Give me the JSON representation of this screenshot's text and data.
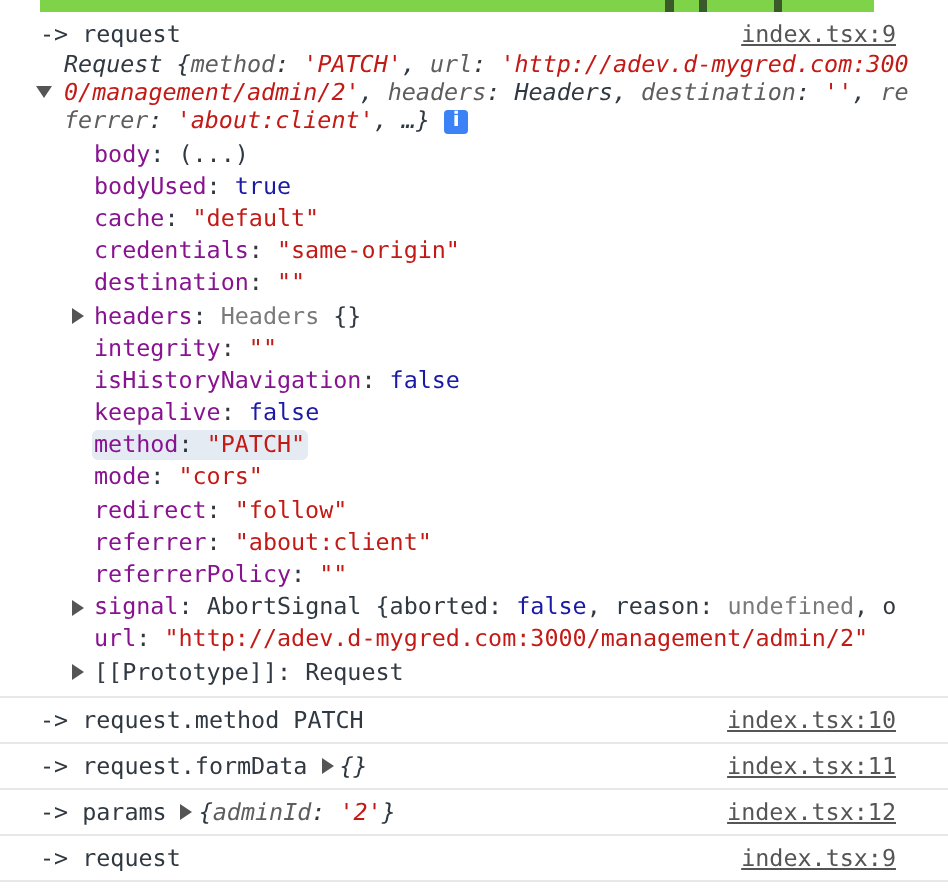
{
  "entries": [
    {
      "message": "-> request",
      "source": "index.tsx:9",
      "object": {
        "expanded": true,
        "info_badge": "i",
        "preview": [
          {
            "text": "Request ",
            "kind": "name"
          },
          {
            "text": "{",
            "kind": "punct"
          },
          {
            "text": "method",
            "kind": "key"
          },
          {
            "text": ": ",
            "kind": "punct"
          },
          {
            "text": "'PATCH'",
            "kind": "string"
          },
          {
            "text": ", ",
            "kind": "punct"
          },
          {
            "text": "url",
            "kind": "key"
          },
          {
            "text": ": ",
            "kind": "punct"
          },
          {
            "text": "'http://adev.d-mygred.com:3000/management/admin/2'",
            "kind": "string"
          },
          {
            "text": ", ",
            "kind": "punct"
          },
          {
            "text": "headers",
            "kind": "key"
          },
          {
            "text": ": ",
            "kind": "punct"
          },
          {
            "text": "Headers",
            "kind": "name"
          },
          {
            "text": ", ",
            "kind": "punct"
          },
          {
            "text": "destination",
            "kind": "key"
          },
          {
            "text": ": ",
            "kind": "punct"
          },
          {
            "text": "''",
            "kind": "string"
          },
          {
            "text": ", ",
            "kind": "punct"
          },
          {
            "text": "referrer",
            "kind": "key"
          },
          {
            "text": ": ",
            "kind": "punct"
          },
          {
            "text": "'about:client'",
            "kind": "string"
          },
          {
            "text": ", …}",
            "kind": "punct"
          }
        ],
        "properties": [
          {
            "key": "body",
            "internal": false,
            "highlighted": false,
            "value": [
              {
                "text": ": ",
                "kind": "punct"
              },
              {
                "text": "(...)",
                "kind": "plain"
              }
            ]
          },
          {
            "key": "bodyUsed",
            "internal": false,
            "highlighted": false,
            "value": [
              {
                "text": ": ",
                "kind": "punct"
              },
              {
                "text": "true",
                "kind": "keyword"
              }
            ]
          },
          {
            "key": "cache",
            "internal": false,
            "highlighted": false,
            "value": [
              {
                "text": ": ",
                "kind": "punct"
              },
              {
                "text": "\"default\"",
                "kind": "string"
              }
            ]
          },
          {
            "key": "credentials",
            "internal": false,
            "highlighted": false,
            "value": [
              {
                "text": ": ",
                "kind": "punct"
              },
              {
                "text": "\"same-origin\"",
                "kind": "string"
              }
            ]
          },
          {
            "key": "destination",
            "internal": false,
            "highlighted": false,
            "value": [
              {
                "text": ": ",
                "kind": "punct"
              },
              {
                "text": "\"\"",
                "kind": "string"
              }
            ]
          },
          {
            "key": "headers",
            "internal": false,
            "expanded": false,
            "highlighted": false,
            "value": [
              {
                "text": ": ",
                "kind": "punct"
              },
              {
                "text": "Headers ",
                "kind": "dim"
              },
              {
                "text": "{}",
                "kind": "plain"
              }
            ]
          },
          {
            "key": "integrity",
            "internal": false,
            "highlighted": false,
            "value": [
              {
                "text": ": ",
                "kind": "punct"
              },
              {
                "text": "\"\"",
                "kind": "string"
              }
            ]
          },
          {
            "key": "isHistoryNavigation",
            "internal": false,
            "highlighted": false,
            "value": [
              {
                "text": ": ",
                "kind": "punct"
              },
              {
                "text": "false",
                "kind": "keyword"
              }
            ]
          },
          {
            "key": "keepalive",
            "internal": false,
            "highlighted": false,
            "value": [
              {
                "text": ": ",
                "kind": "punct"
              },
              {
                "text": "false",
                "kind": "keyword"
              }
            ]
          },
          {
            "key": "method",
            "internal": false,
            "highlighted": true,
            "value": [
              {
                "text": ": ",
                "kind": "punct"
              },
              {
                "text": "\"PATCH\"",
                "kind": "string"
              }
            ]
          },
          {
            "key": "mode",
            "internal": false,
            "highlighted": false,
            "value": [
              {
                "text": ": ",
                "kind": "punct"
              },
              {
                "text": "\"cors\"",
                "kind": "string"
              }
            ]
          },
          {
            "key": "redirect",
            "internal": false,
            "highlighted": false,
            "value": [
              {
                "text": ": ",
                "kind": "punct"
              },
              {
                "text": "\"follow\"",
                "kind": "string"
              }
            ]
          },
          {
            "key": "referrer",
            "internal": false,
            "highlighted": false,
            "value": [
              {
                "text": ": ",
                "kind": "punct"
              },
              {
                "text": "\"about:client\"",
                "kind": "string"
              }
            ]
          },
          {
            "key": "referrerPolicy",
            "internal": false,
            "highlighted": false,
            "value": [
              {
                "text": ": ",
                "kind": "punct"
              },
              {
                "text": "\"\"",
                "kind": "string"
              }
            ]
          },
          {
            "key": "signal",
            "internal": false,
            "expanded": false,
            "highlighted": false,
            "value": [
              {
                "text": ": ",
                "kind": "punct"
              },
              {
                "text": "AbortSignal {aborted: ",
                "kind": "plain"
              },
              {
                "text": "false",
                "kind": "keyword"
              },
              {
                "text": ", reason: ",
                "kind": "plain"
              },
              {
                "text": "undefined",
                "kind": "dim"
              },
              {
                "text": ", o",
                "kind": "plain"
              }
            ]
          },
          {
            "key": "url",
            "internal": false,
            "highlighted": false,
            "value": [
              {
                "text": ": ",
                "kind": "punct"
              },
              {
                "text": "\"http://adev.d-mygred.com:3000/management/admin/2\"",
                "kind": "string"
              }
            ]
          },
          {
            "key": "[[Prototype]]",
            "internal": true,
            "expanded": false,
            "highlighted": false,
            "value": [
              {
                "text": ": ",
                "kind": "punct"
              },
              {
                "text": "Request",
                "kind": "plain"
              }
            ]
          }
        ]
      }
    },
    {
      "message": "-> request.method PATCH",
      "source": "index.tsx:10"
    },
    {
      "message": "-> request.formData",
      "source": "index.tsx:11",
      "preview": {
        "expanded": false,
        "segments": [
          {
            "text": "{}",
            "kind": "punct"
          }
        ]
      }
    },
    {
      "message": "-> params",
      "source": "index.tsx:12",
      "preview": {
        "expanded": false,
        "segments": [
          {
            "text": "{",
            "kind": "punct"
          },
          {
            "text": "adminId",
            "kind": "key"
          },
          {
            "text": ": ",
            "kind": "punct"
          },
          {
            "text": "'2'",
            "kind": "string"
          },
          {
            "text": "}",
            "kind": "punct"
          }
        ]
      }
    },
    {
      "message": "-> request",
      "source": "index.tsx:9"
    }
  ]
}
